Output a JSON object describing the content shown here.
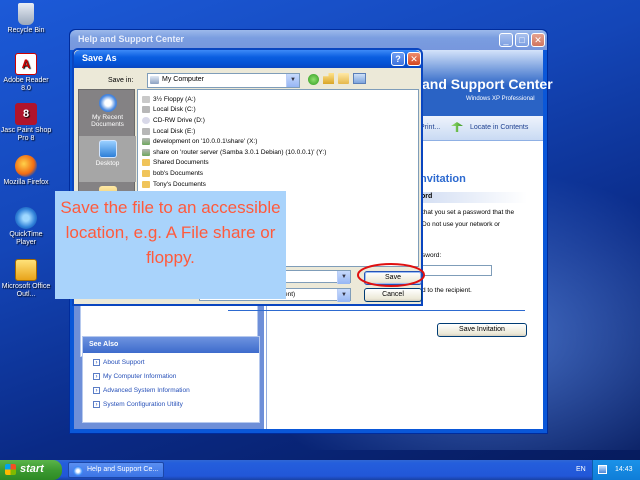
{
  "desktop": {
    "icons": [
      {
        "label": "Recycle Bin"
      },
      {
        "label": "Adobe Reader 8.0"
      },
      {
        "label": "Jasc Paint Shop Pro 8"
      },
      {
        "label": "Mozilla Firefox"
      },
      {
        "label": "QuickTime Player"
      },
      {
        "label": "Microsoft Office Outl..."
      }
    ]
  },
  "help_window": {
    "title": "Help and Support Center",
    "brand": "and Support Center",
    "edition": "Windows XP Professional",
    "toolbar": {
      "print": "Print...",
      "locate": "Locate in Contents"
    },
    "right_pane": {
      "heading": "nvitation",
      "section_label": "ord",
      "text_line1": "that you set a password that the",
      "text_line2": "Do not use your network or",
      "password_label": "sword:",
      "recipient_text": "d to the recipient.",
      "save_invitation": "Save Invitation"
    },
    "see_also": {
      "title": "See Also",
      "items": [
        "About Support",
        "My Computer Information",
        "Advanced System Information",
        "System Configuration Utility"
      ]
    }
  },
  "save_as": {
    "title": "Save As",
    "help_btn": "?",
    "close_btn": "✕",
    "save_in_label": "Save in:",
    "save_in_value": "My Computer",
    "places": [
      {
        "label": "My Recent Documents"
      },
      {
        "label": "Desktop"
      }
    ],
    "files": [
      "3½ Floppy (A:)",
      "Local Disk (C:)",
      "CD-RW Drive (D:)",
      "Local Disk (E:)",
      "development on '10.0.0.1\\share' (X:)",
      "share on 'router server (Samba 3.0.1 Debian) (10.0.0.1)' (Y:)",
      "Shared Documents",
      "bob's Documents",
      "Tony's Documents"
    ],
    "file_type_value": "ent)",
    "save_label": "Save",
    "cancel_label": "Cancel"
  },
  "callout": {
    "text": "Save the file to an accessible location, e.g. A File share or floppy."
  },
  "taskbar": {
    "start": "start",
    "task": "Help and Support Ce...",
    "lang": "EN",
    "time": "14:43"
  },
  "colors": {
    "callout_bg": "#a9d3fb",
    "callout_text": "#ff5a3c",
    "highlight_ring": "#e01010",
    "xp_blue": "#0a57d8"
  }
}
